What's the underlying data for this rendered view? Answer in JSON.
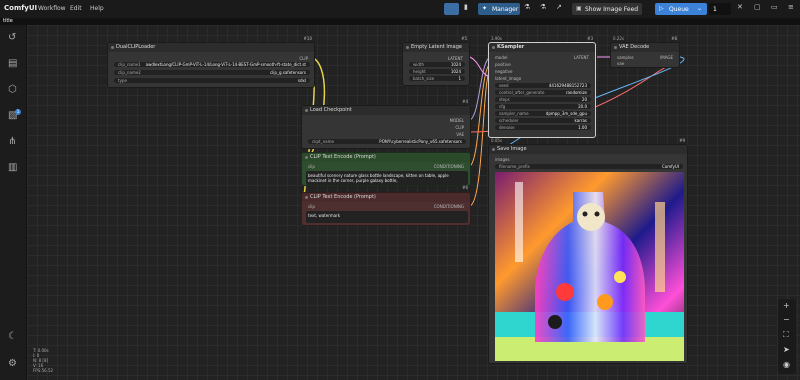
{
  "app": {
    "logo": "ComfyUI",
    "menu": [
      "Workflow",
      "Edit",
      "Help"
    ],
    "tab": "title",
    "manager_label": "Manager",
    "image_feed_label": "Show Image Feed",
    "queue_label": "Queue",
    "queue_count": "1"
  },
  "hud": [
    "T: 0.00s",
    "I: 0",
    "N: 8 [8]",
    "V: 16",
    "FPS:56.52"
  ],
  "nodes": {
    "dualclip": {
      "id": "#10",
      "title": "DualCLIPLoader",
      "out": "CLIP",
      "w": [
        {
          "label": "clip_name1",
          "value": "awdlextLong/CLIP-GmP-ViT-L-14/Long-ViT-L-14-BEST-GmP-smooth-ft-state_dict.st"
        },
        {
          "label": "clip_name2",
          "value": "clip_g.safetensors"
        },
        {
          "label": "type",
          "value": "sdxl"
        }
      ]
    },
    "empty": {
      "id": "#5",
      "title": "Empty Latent Image",
      "out": "LATENT",
      "w": [
        {
          "label": "width",
          "value": "1024"
        },
        {
          "label": "height",
          "value": "1024"
        },
        {
          "label": "batch_size",
          "value": "1"
        }
      ]
    },
    "ksampler": {
      "id": "#3",
      "time": "3.90s",
      "title": "KSampler",
      "inputs": [
        "model",
        "positive",
        "negative",
        "latent_image"
      ],
      "out": "LATENT",
      "w": [
        {
          "label": "seed",
          "value": "441629488152723"
        },
        {
          "label": "control_after_generate",
          "value": "randomize"
        },
        {
          "label": "steps",
          "value": "20"
        },
        {
          "label": "cfg",
          "value": "20.0"
        },
        {
          "label": "sampler_name",
          "value": "dpmpp_3m_sde_gpu"
        },
        {
          "label": "scheduler",
          "value": "karras"
        },
        {
          "label": "denoise",
          "value": "1.00"
        }
      ]
    },
    "vae": {
      "id": "#8",
      "time": "0.22s",
      "title": "VAE Decode",
      "inputs": [
        "samples",
        "vae"
      ],
      "out": "IMAGE"
    },
    "ckpt": {
      "id": "#4",
      "title": "Load Checkpoint",
      "outs": [
        "MODEL",
        "CLIP",
        "VAE"
      ],
      "w": [
        {
          "label": "ckpt_name",
          "value": "PONY\\cyberrealisticPony_v65.safetensors"
        }
      ]
    },
    "pos": {
      "id": "#6",
      "title": "CLIP Text Encode (Prompt)",
      "in": "clip",
      "out": "CONDITIONING",
      "text": "beautiful scenery nature glass bottle landscape, kitten on table, apple mackinet in the corner, purple galaxy bottle,"
    },
    "neg": {
      "id": "#7",
      "title": "CLIP Text Encode (Prompt)",
      "in": "clip",
      "out": "CONDITIONING",
      "text": "text, watermark"
    },
    "save": {
      "id": "#9",
      "time": "0.05s",
      "title": "Save Image",
      "in": "images",
      "w": [
        {
          "label": "filename_prefix",
          "value": "ComfyUI"
        }
      ]
    }
  }
}
